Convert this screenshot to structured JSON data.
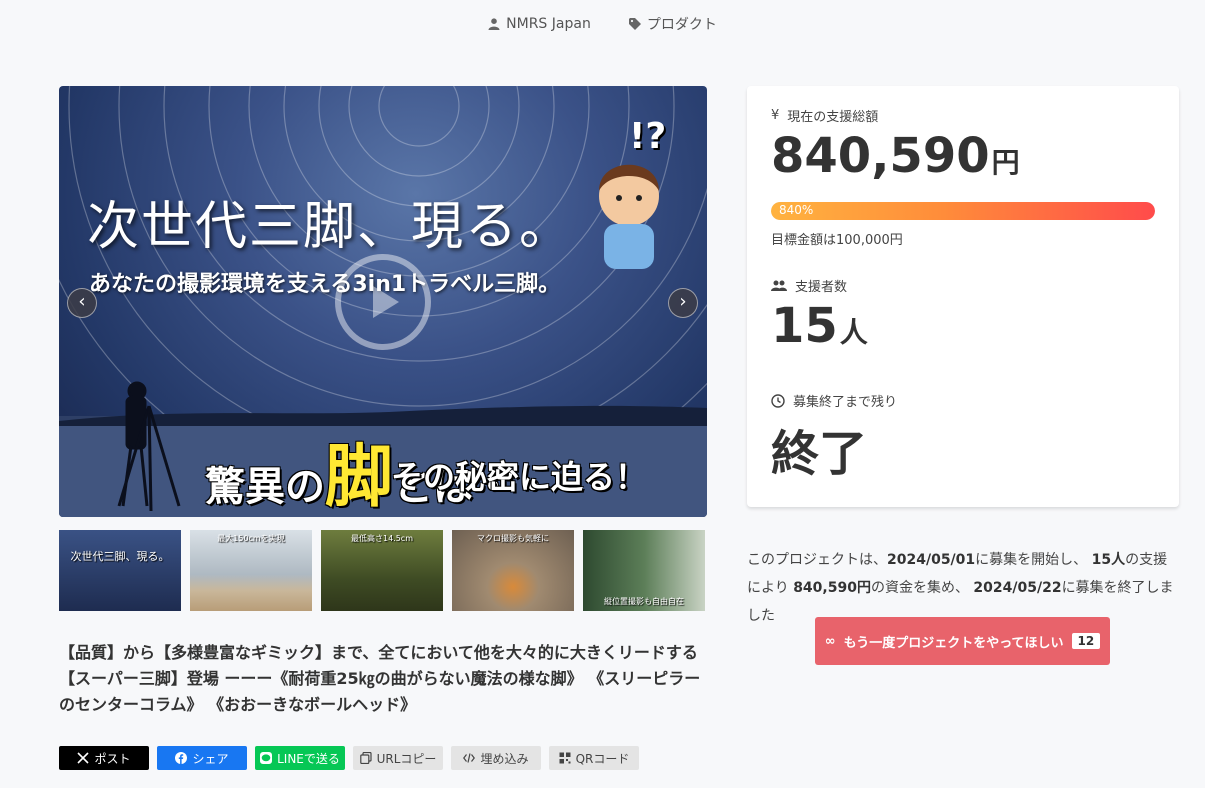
{
  "topbar": {
    "owner": "NMRS Japan",
    "category": "プロダクト"
  },
  "hero": {
    "title_line1": "次世代三脚、現る。",
    "title_line2": "あなたの撮影環境を支える3in1トラベル三脚。",
    "title_line3_a": "驚異の",
    "title_line3_big": "脚",
    "title_line3_b": "とは・・",
    "title_line4": "その秘密に迫る！",
    "badge": "!?",
    "prev": "‹",
    "next": "›"
  },
  "thumbnails": [
    {
      "caption": "次世代三脚、現る。",
      "color": "#2c3e6b"
    },
    {
      "caption": "最大150cmを実現",
      "color": "#b9c2c8"
    },
    {
      "caption": "最低高さ14.5cm",
      "color": "#4d5b2f"
    },
    {
      "caption": "マクロ撮影も気軽に",
      "color": "#8a7a66"
    },
    {
      "caption": "縦位置撮影も自由自在",
      "color": "#4a6b48"
    }
  ],
  "description": "【品質】から【多様豊富なギミック】まで、全てにおいて他を大々的に大きくリードする【スーパー三脚】登場 ーーー《耐荷重25㎏の曲がらない魔法の様な脚》 《スリーピラーのセンターコラム》 《おおーきなボールヘッド》",
  "share": {
    "x": "ポスト",
    "facebook": "シェア",
    "line": "LINEで送る",
    "url": "URLコピー",
    "embed": "埋め込み",
    "qr": "QRコード"
  },
  "stats": {
    "total_label": "現在の支援総額",
    "total_value": "840,590",
    "total_unit": "円",
    "progress_label": "840%",
    "progress_fraction": 1.0,
    "goal_text": "目標金額は100,000円",
    "backers_label": "支援者数",
    "backers_value": "15",
    "backers_unit": "人",
    "remaining_label": "募集終了まで残り",
    "remaining_value": "終了"
  },
  "summary": {
    "p1": "このプロジェクトは、",
    "start": "2024/05/01",
    "p2": "に募集を開始し、",
    "backers": "15人",
    "p3": "の支援により",
    "amount": "840,590円",
    "p4": "の資金を集め、",
    "end": "2024/05/22",
    "p5": "に募集を終了しました"
  },
  "again_button": {
    "label": "もう一度プロジェクトをやってほしい",
    "count": "12"
  },
  "colors": {
    "accent": "#e8636b",
    "progress_start": "#ffb340",
    "progress_end": "#ff4b4b"
  }
}
